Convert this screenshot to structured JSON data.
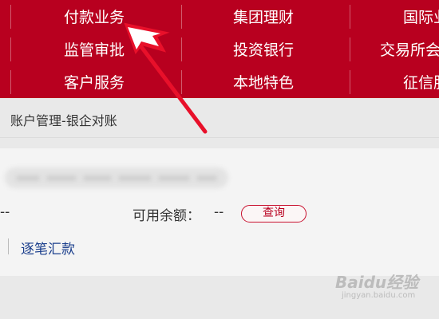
{
  "nav": {
    "rows": [
      [
        "付款业务",
        "集团理财",
        "国际业"
      ],
      [
        "监管审批",
        "投资银行",
        "交易所会"
      ],
      [
        "客户服务",
        "本地特色",
        "征信服"
      ]
    ]
  },
  "breadcrumb": "账户管理-银企对账",
  "account": {
    "left_value": "--",
    "balance_label": "可用余额：",
    "balance_value": "--",
    "query_button": "查询",
    "link_label": "逐笔汇款"
  },
  "watermark": {
    "brand": "Baidu经验",
    "url": "jingyan.baidu.com"
  },
  "colors": {
    "nav_bg": "#b8001f",
    "accent": "#c8102e",
    "link": "#1a3e8c",
    "annotation_arrow": "#e8102a"
  }
}
